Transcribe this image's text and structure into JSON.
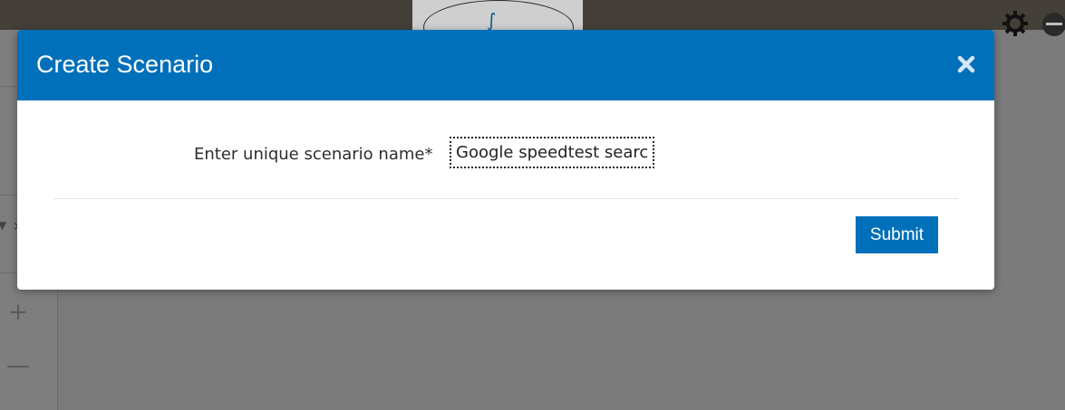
{
  "modal": {
    "title": "Create Scenario",
    "close_icon": "close-icon",
    "field_label": "Enter unique scenario name*",
    "field_value": "Google speedtest search",
    "submit_label": "Submit"
  },
  "background": {
    "left_panel_tools": [
      "+",
      "—"
    ],
    "icons": [
      "gear-icon",
      "minus-circle-icon",
      "caret-down-icon"
    ]
  },
  "colors": {
    "header_blue": "#0070bb",
    "button_blue": "#0070bb",
    "topbar": "#453f39",
    "overlay_gray": "#7a7a7a"
  }
}
